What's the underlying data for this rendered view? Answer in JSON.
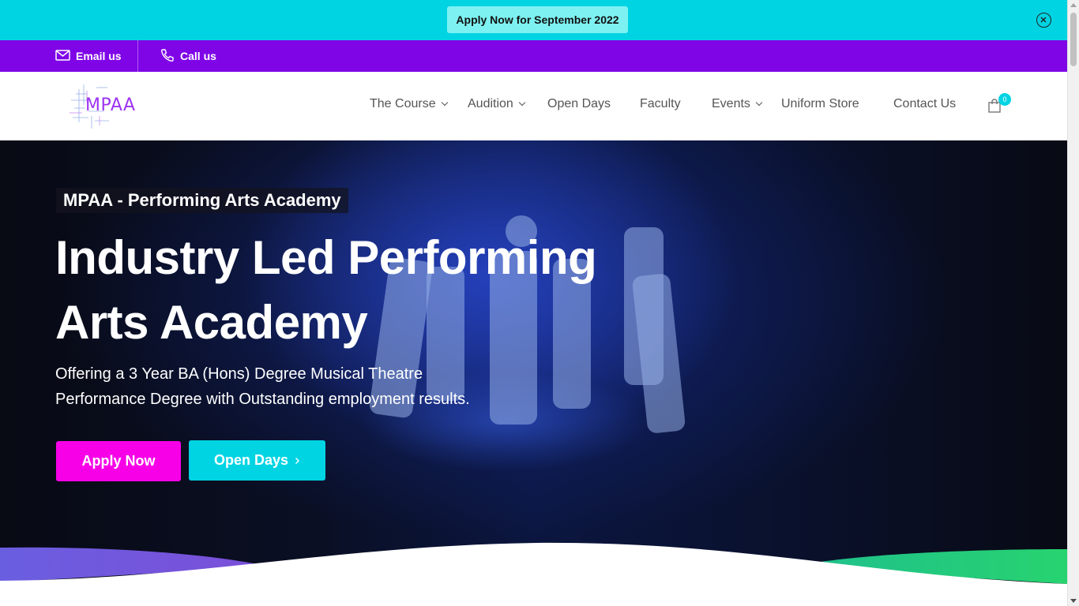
{
  "announcement": {
    "label": "Apply Now for September 2022"
  },
  "contact": {
    "email_label": "Email us",
    "call_label": "Call us"
  },
  "header": {
    "logo_text": "MPAA",
    "nav": [
      {
        "label": "The Course",
        "has_dropdown": true
      },
      {
        "label": "Audition",
        "has_dropdown": true
      },
      {
        "label": "Open Days",
        "has_dropdown": false
      },
      {
        "label": "Faculty",
        "has_dropdown": false
      },
      {
        "label": "Events",
        "has_dropdown": true
      },
      {
        "label": "Uniform Store",
        "has_dropdown": false
      },
      {
        "label": "Contact Us",
        "has_dropdown": false
      }
    ],
    "cart_count": "0"
  },
  "hero": {
    "tag": "MPAA - Performing Arts Academy",
    "title_line1": "Industry Led Performing",
    "title_line2": "Arts Academy",
    "subtitle_line1": "Offering a 3 Year BA (Hons) Degree Musical Theatre",
    "subtitle_line2": "Performance Degree with Outstanding employment results.",
    "apply_label": "Apply Now",
    "open_days_label": "Open Days"
  },
  "colors": {
    "cyan": "#00d4e3",
    "purple": "#7f05e7",
    "magenta": "#f700e8",
    "nav_text": "#555555"
  }
}
